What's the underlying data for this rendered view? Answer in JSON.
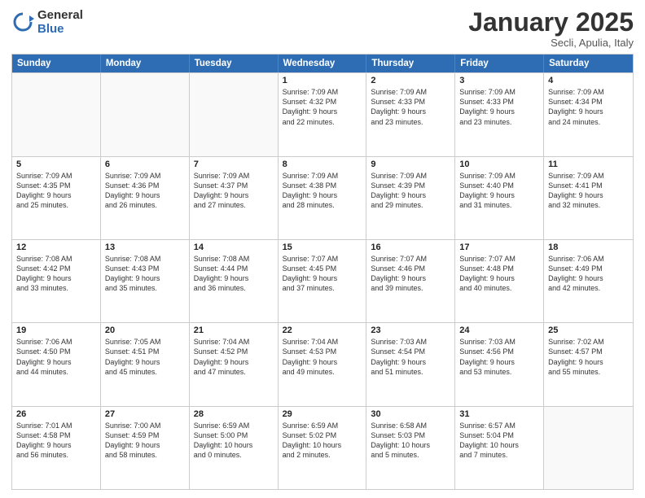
{
  "header": {
    "logo_general": "General",
    "logo_blue": "Blue",
    "month_title": "January 2025",
    "location": "Secli, Apulia, Italy"
  },
  "weekdays": [
    "Sunday",
    "Monday",
    "Tuesday",
    "Wednesday",
    "Thursday",
    "Friday",
    "Saturday"
  ],
  "rows": [
    [
      {
        "day": "",
        "lines": [],
        "empty": true
      },
      {
        "day": "",
        "lines": [],
        "empty": true
      },
      {
        "day": "",
        "lines": [],
        "empty": true
      },
      {
        "day": "1",
        "lines": [
          "Sunrise: 7:09 AM",
          "Sunset: 4:32 PM",
          "Daylight: 9 hours",
          "and 22 minutes."
        ],
        "empty": false
      },
      {
        "day": "2",
        "lines": [
          "Sunrise: 7:09 AM",
          "Sunset: 4:33 PM",
          "Daylight: 9 hours",
          "and 23 minutes."
        ],
        "empty": false
      },
      {
        "day": "3",
        "lines": [
          "Sunrise: 7:09 AM",
          "Sunset: 4:33 PM",
          "Daylight: 9 hours",
          "and 23 minutes."
        ],
        "empty": false
      },
      {
        "day": "4",
        "lines": [
          "Sunrise: 7:09 AM",
          "Sunset: 4:34 PM",
          "Daylight: 9 hours",
          "and 24 minutes."
        ],
        "empty": false
      }
    ],
    [
      {
        "day": "5",
        "lines": [
          "Sunrise: 7:09 AM",
          "Sunset: 4:35 PM",
          "Daylight: 9 hours",
          "and 25 minutes."
        ],
        "empty": false
      },
      {
        "day": "6",
        "lines": [
          "Sunrise: 7:09 AM",
          "Sunset: 4:36 PM",
          "Daylight: 9 hours",
          "and 26 minutes."
        ],
        "empty": false
      },
      {
        "day": "7",
        "lines": [
          "Sunrise: 7:09 AM",
          "Sunset: 4:37 PM",
          "Daylight: 9 hours",
          "and 27 minutes."
        ],
        "empty": false
      },
      {
        "day": "8",
        "lines": [
          "Sunrise: 7:09 AM",
          "Sunset: 4:38 PM",
          "Daylight: 9 hours",
          "and 28 minutes."
        ],
        "empty": false
      },
      {
        "day": "9",
        "lines": [
          "Sunrise: 7:09 AM",
          "Sunset: 4:39 PM",
          "Daylight: 9 hours",
          "and 29 minutes."
        ],
        "empty": false
      },
      {
        "day": "10",
        "lines": [
          "Sunrise: 7:09 AM",
          "Sunset: 4:40 PM",
          "Daylight: 9 hours",
          "and 31 minutes."
        ],
        "empty": false
      },
      {
        "day": "11",
        "lines": [
          "Sunrise: 7:09 AM",
          "Sunset: 4:41 PM",
          "Daylight: 9 hours",
          "and 32 minutes."
        ],
        "empty": false
      }
    ],
    [
      {
        "day": "12",
        "lines": [
          "Sunrise: 7:08 AM",
          "Sunset: 4:42 PM",
          "Daylight: 9 hours",
          "and 33 minutes."
        ],
        "empty": false
      },
      {
        "day": "13",
        "lines": [
          "Sunrise: 7:08 AM",
          "Sunset: 4:43 PM",
          "Daylight: 9 hours",
          "and 35 minutes."
        ],
        "empty": false
      },
      {
        "day": "14",
        "lines": [
          "Sunrise: 7:08 AM",
          "Sunset: 4:44 PM",
          "Daylight: 9 hours",
          "and 36 minutes."
        ],
        "empty": false
      },
      {
        "day": "15",
        "lines": [
          "Sunrise: 7:07 AM",
          "Sunset: 4:45 PM",
          "Daylight: 9 hours",
          "and 37 minutes."
        ],
        "empty": false
      },
      {
        "day": "16",
        "lines": [
          "Sunrise: 7:07 AM",
          "Sunset: 4:46 PM",
          "Daylight: 9 hours",
          "and 39 minutes."
        ],
        "empty": false
      },
      {
        "day": "17",
        "lines": [
          "Sunrise: 7:07 AM",
          "Sunset: 4:48 PM",
          "Daylight: 9 hours",
          "and 40 minutes."
        ],
        "empty": false
      },
      {
        "day": "18",
        "lines": [
          "Sunrise: 7:06 AM",
          "Sunset: 4:49 PM",
          "Daylight: 9 hours",
          "and 42 minutes."
        ],
        "empty": false
      }
    ],
    [
      {
        "day": "19",
        "lines": [
          "Sunrise: 7:06 AM",
          "Sunset: 4:50 PM",
          "Daylight: 9 hours",
          "and 44 minutes."
        ],
        "empty": false
      },
      {
        "day": "20",
        "lines": [
          "Sunrise: 7:05 AM",
          "Sunset: 4:51 PM",
          "Daylight: 9 hours",
          "and 45 minutes."
        ],
        "empty": false
      },
      {
        "day": "21",
        "lines": [
          "Sunrise: 7:04 AM",
          "Sunset: 4:52 PM",
          "Daylight: 9 hours",
          "and 47 minutes."
        ],
        "empty": false
      },
      {
        "day": "22",
        "lines": [
          "Sunrise: 7:04 AM",
          "Sunset: 4:53 PM",
          "Daylight: 9 hours",
          "and 49 minutes."
        ],
        "empty": false
      },
      {
        "day": "23",
        "lines": [
          "Sunrise: 7:03 AM",
          "Sunset: 4:54 PM",
          "Daylight: 9 hours",
          "and 51 minutes."
        ],
        "empty": false
      },
      {
        "day": "24",
        "lines": [
          "Sunrise: 7:03 AM",
          "Sunset: 4:56 PM",
          "Daylight: 9 hours",
          "and 53 minutes."
        ],
        "empty": false
      },
      {
        "day": "25",
        "lines": [
          "Sunrise: 7:02 AM",
          "Sunset: 4:57 PM",
          "Daylight: 9 hours",
          "and 55 minutes."
        ],
        "empty": false
      }
    ],
    [
      {
        "day": "26",
        "lines": [
          "Sunrise: 7:01 AM",
          "Sunset: 4:58 PM",
          "Daylight: 9 hours",
          "and 56 minutes."
        ],
        "empty": false
      },
      {
        "day": "27",
        "lines": [
          "Sunrise: 7:00 AM",
          "Sunset: 4:59 PM",
          "Daylight: 9 hours",
          "and 58 minutes."
        ],
        "empty": false
      },
      {
        "day": "28",
        "lines": [
          "Sunrise: 6:59 AM",
          "Sunset: 5:00 PM",
          "Daylight: 10 hours",
          "and 0 minutes."
        ],
        "empty": false
      },
      {
        "day": "29",
        "lines": [
          "Sunrise: 6:59 AM",
          "Sunset: 5:02 PM",
          "Daylight: 10 hours",
          "and 2 minutes."
        ],
        "empty": false
      },
      {
        "day": "30",
        "lines": [
          "Sunrise: 6:58 AM",
          "Sunset: 5:03 PM",
          "Daylight: 10 hours",
          "and 5 minutes."
        ],
        "empty": false
      },
      {
        "day": "31",
        "lines": [
          "Sunrise: 6:57 AM",
          "Sunset: 5:04 PM",
          "Daylight: 10 hours",
          "and 7 minutes."
        ],
        "empty": false
      },
      {
        "day": "",
        "lines": [],
        "empty": true
      }
    ]
  ]
}
